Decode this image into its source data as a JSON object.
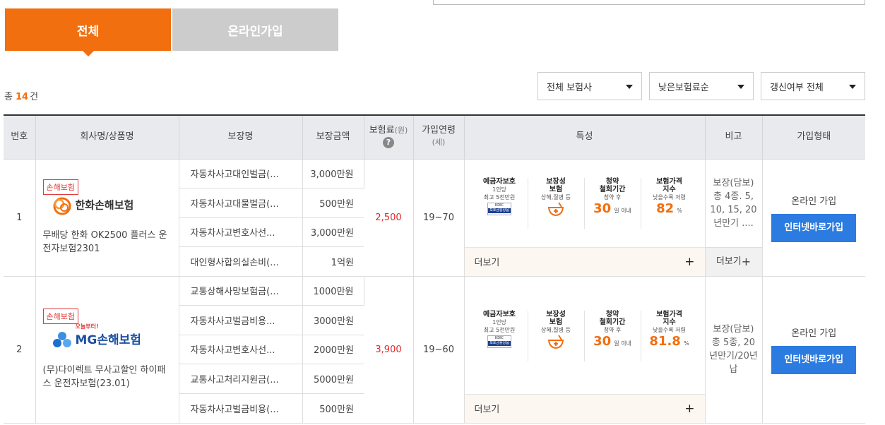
{
  "tabs": {
    "all": "전체",
    "online": "온라인가입"
  },
  "total": {
    "prefix": "총",
    "count": "14",
    "suffix": "건"
  },
  "filters": {
    "company": "전체 보험사",
    "sort": "낮은보험료순",
    "renew": "갱신여부 전체"
  },
  "headers": {
    "no": "번호",
    "company": "회사명/상품명",
    "coverage": "보장명",
    "amount": "보장금액",
    "premium": "보험료",
    "premium_unit": "(원)",
    "age": "가입연령",
    "age_unit": "(세)",
    "features": "특성",
    "note": "비고",
    "join": "가입형태"
  },
  "rows": [
    {
      "no": "1",
      "badge": "손해보험",
      "company_logo": "한화손해보험",
      "product": "무배당 한화 OK2500 플러스 운전자보험2301",
      "coverages": [
        {
          "name": "자동차사고대인벌금(...",
          "amount": "3,000만원"
        },
        {
          "name": "자동차사고대물벌금(...",
          "amount": "500만원"
        },
        {
          "name": "자동차사고변호사선...",
          "amount": "3,000만원"
        },
        {
          "name": "대인형사합의실손비(...",
          "amount": "1억원"
        }
      ],
      "premium": "2,500",
      "age": "19~70",
      "features": {
        "deposit_title": "예금자보호",
        "deposit_sub1": "1인당",
        "deposit_sub2": "최고 5천만원",
        "kdic_top": "KDIC",
        "kdic_label": "보호금융상품",
        "cov_title1": "보장성",
        "cov_title2": "보험",
        "cov_sub": "상해,질병 등",
        "cancel_title1": "청약",
        "cancel_title2": "철회기간",
        "cancel_sub": "청약 후",
        "cancel_days": "30",
        "cancel_unit": "일 이내",
        "price_title1": "보험가격",
        "price_title2": "지수",
        "price_sub": "낮을수록 저렴",
        "price_index": "82",
        "price_unit": "%"
      },
      "more": "더보기",
      "note": "보장(담보) 총 4종. 5, 10, 15, 20년만기 ....",
      "note_more": "더보기",
      "join_type": "온라인 가입",
      "join_button": "인터넷바로가입"
    },
    {
      "no": "2",
      "badge": "손해보험",
      "company_logo_top": "오늘부터!",
      "company_logo": "MG손해보험",
      "product": "(무)다이렉트 무사고할인 하이패스 운전자보험(23.01)",
      "coverages": [
        {
          "name": "교통상해사망보험금(...",
          "amount": "1000만원"
        },
        {
          "name": "자동차사고벌금비용...",
          "amount": "3000만원"
        },
        {
          "name": "자동차사고변호사선...",
          "amount": "2000만원"
        },
        {
          "name": "교통사고처리지원금(...",
          "amount": "5000만원"
        },
        {
          "name": "자동차사고벌금비용(...",
          "amount": "500만원"
        }
      ],
      "premium": "3,900",
      "age": "19~60",
      "features": {
        "deposit_title": "예금자보호",
        "deposit_sub1": "1인당",
        "deposit_sub2": "최고 5천만원",
        "kdic_top": "KDIC",
        "kdic_label": "보호금융상품",
        "cov_title1": "보장성",
        "cov_title2": "보험",
        "cov_sub": "상해,질병 등",
        "cancel_title1": "청약",
        "cancel_title2": "철회기간",
        "cancel_sub": "청약 후",
        "cancel_days": "30",
        "cancel_unit": "일 이내",
        "price_title1": "보험가격",
        "price_title2": "지수",
        "price_sub": "낮을수록 저렴",
        "price_index": "81.8",
        "price_unit": "%"
      },
      "more": "더보기",
      "note": "보장(담보) 총 5종, 20년만기/20년납",
      "join_type": "온라인 가입",
      "join_button": "인터넷바로가입"
    }
  ],
  "colors": {
    "accent": "#f26f0f",
    "button": "#2b7be0",
    "price": "#e0262a"
  }
}
